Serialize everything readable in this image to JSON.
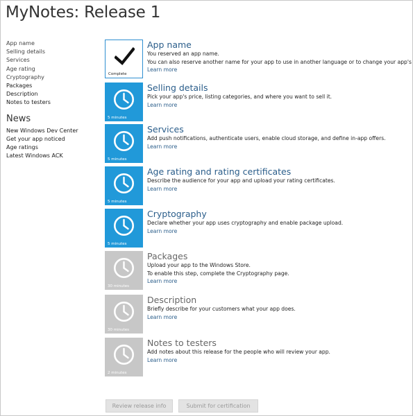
{
  "page": {
    "title": "MyNotes: Release 1"
  },
  "sidebar": {
    "links": [
      {
        "label": "App name",
        "enabled": false
      },
      {
        "label": "Selling details",
        "enabled": false
      },
      {
        "label": "Services",
        "enabled": false
      },
      {
        "label": "Age rating",
        "enabled": false
      },
      {
        "label": "Cryptography",
        "enabled": false
      },
      {
        "label": "Packages",
        "enabled": true
      },
      {
        "label": "Description",
        "enabled": true
      },
      {
        "label": "Notes to testers",
        "enabled": true
      }
    ],
    "news_heading": "News",
    "news_links": [
      {
        "label": "New Windows Dev Center"
      },
      {
        "label": "Get your app noticed"
      },
      {
        "label": "Age ratings"
      },
      {
        "label": "Latest Windows ACK"
      }
    ]
  },
  "steps": [
    {
      "title": "App name",
      "tile_label": "Complete",
      "state": "complete",
      "icon": "checkmark-icon",
      "description": [
        "You reserved an app name.",
        "You can also reserve another name for your app to use in another language or to change your app's name."
      ],
      "learn_more": "Learn more"
    },
    {
      "title": "Selling details",
      "tile_label": "5 minutes",
      "state": "active",
      "icon": "clock-icon",
      "description": [
        "Pick your app's price, listing categories, and where you want to sell it."
      ],
      "learn_more": "Learn more"
    },
    {
      "title": "Services",
      "tile_label": "5 minutes",
      "state": "active",
      "icon": "clock-icon",
      "description": [
        "Add push notifications, authenticate users, enable cloud storage, and define in-app offers."
      ],
      "learn_more": "Learn more"
    },
    {
      "title": "Age rating and rating certificates",
      "tile_label": "5 minutes",
      "state": "active",
      "icon": "clock-icon",
      "description": [
        "Describe the audience for your app and upload your rating certificates."
      ],
      "learn_more": "Learn more"
    },
    {
      "title": "Cryptography",
      "tile_label": "5 minutes",
      "state": "active",
      "icon": "clock-icon",
      "description": [
        "Declare whether your app uses cryptography and enable package upload."
      ],
      "learn_more": "Learn more"
    },
    {
      "title": "Packages",
      "tile_label": "30 minutes",
      "state": "inactive",
      "icon": "clock-icon",
      "description": [
        "Upload your app to the Windows Store.",
        "To enable this step, complete the Cryptography page."
      ],
      "learn_more": "Learn more"
    },
    {
      "title": "Description",
      "tile_label": "30 minutes",
      "state": "inactive",
      "icon": "clock-icon",
      "description": [
        "Briefly describe for your customers what your app does."
      ],
      "learn_more": "Learn more"
    },
    {
      "title": "Notes to testers",
      "tile_label": "2 minutes",
      "state": "inactive",
      "icon": "clock-icon",
      "description": [
        "Add notes about this release for the people who will review your app."
      ],
      "learn_more": "Learn more"
    }
  ],
  "buttons": {
    "review": "Review release info",
    "submit": "Submit for certification"
  },
  "colors": {
    "active_tile": "#2199d9",
    "inactive_tile": "#c7c7c7",
    "link": "#2a5d8a"
  }
}
